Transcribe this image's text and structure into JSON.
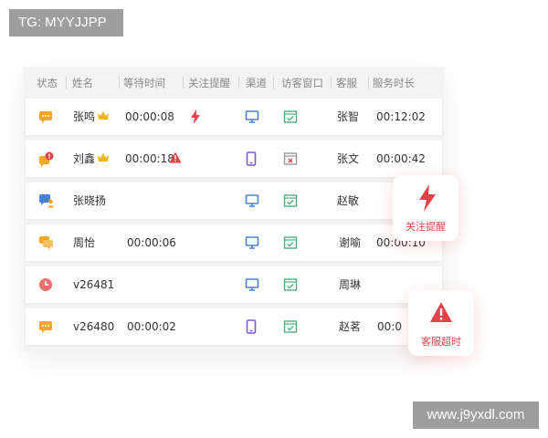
{
  "watermarks": {
    "top_left": "TG: MYYJJPP",
    "bottom_right": "www.j9yxdl.com"
  },
  "table": {
    "columns": [
      "状态",
      "姓名",
      "等待时间",
      "关注提醒",
      "渠道",
      "访客窗口",
      "客服",
      "服务时长"
    ],
    "rows": [
      {
        "status_icon": "chat-bubble-icon",
        "name": "张鸣",
        "vip": true,
        "wait_time": "00:00:08",
        "alert_icon": "lightning-icon",
        "channel_icon": "desktop-icon",
        "window_icon": "window-check-icon",
        "agent": "张智",
        "service_time": "00:12:02"
      },
      {
        "status_icon": "chat-bubble-alert-icon",
        "name": "刘鑫",
        "vip": true,
        "wait_time": "00:00:18",
        "alert_icon": "warning-triangle-icon",
        "channel_icon": "mobile-icon",
        "window_icon": "window-closed-icon",
        "agent": "张文",
        "service_time": "00:00:42"
      },
      {
        "status_icon": "transfer-user-icon",
        "name": "张晓扬",
        "vip": false,
        "wait_time": "",
        "alert_icon": "",
        "channel_icon": "desktop-icon",
        "window_icon": "window-check-icon",
        "agent": "赵敏",
        "service_time": ""
      },
      {
        "status_icon": "chat-bubbles-icon",
        "name": "周怡",
        "vip": false,
        "wait_time": "00:00:06",
        "alert_icon": "",
        "channel_icon": "desktop-icon",
        "window_icon": "window-check-icon",
        "agent": "谢喻",
        "service_time": "00:00:10"
      },
      {
        "status_icon": "clock-icon",
        "name": "v26481",
        "vip": false,
        "wait_time": "",
        "alert_icon": "",
        "channel_icon": "desktop-icon",
        "window_icon": "window-check-icon",
        "agent": "周琳",
        "service_time": ""
      },
      {
        "status_icon": "chat-bubble-icon",
        "name": "v26480",
        "vip": false,
        "wait_time": "00:00:02",
        "alert_icon": "",
        "channel_icon": "mobile-icon",
        "window_icon": "window-check-icon",
        "agent": "赵茗",
        "service_time": "00:0"
      }
    ]
  },
  "callouts": {
    "follow_alert": {
      "label": "关注提醒",
      "icon": "lightning-icon"
    },
    "service_timeout": {
      "label": "客服超时",
      "icon": "warning-triangle-icon"
    }
  },
  "colors": {
    "alert_red": "#e3424a",
    "status_orange": "#f5a623",
    "channel_blue": "#4a7fd6",
    "mobile_purple": "#7b5cc9",
    "window_green": "#4caf7d",
    "crown_gold": "#f2b21c"
  }
}
